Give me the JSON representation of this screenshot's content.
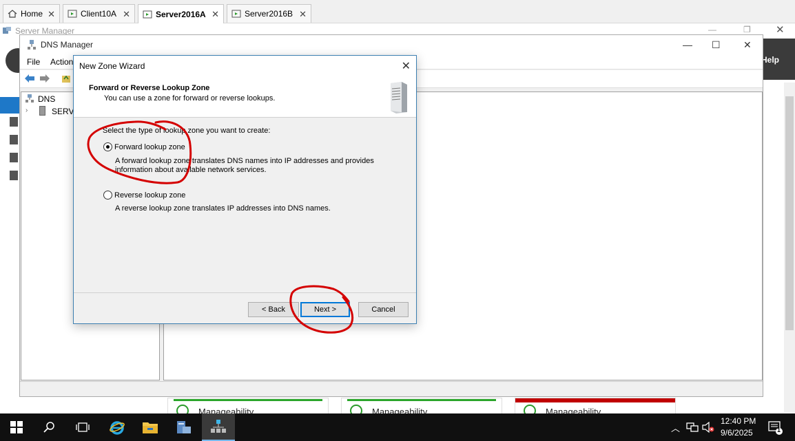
{
  "vm_tabs": [
    {
      "label": "Home",
      "active": false
    },
    {
      "label": "Client10A",
      "active": false
    },
    {
      "label": "Server2016A",
      "active": true
    },
    {
      "label": "Server2016B",
      "active": false
    }
  ],
  "server_manager": {
    "title": "Server Manager",
    "help_label": "Help",
    "tiles": [
      {
        "label": "Manageability",
        "status_color": "#2aa52a"
      },
      {
        "label": "Manageability",
        "status_color": "#2aa52a"
      },
      {
        "label": "Manageability",
        "status_color": "#c00000"
      }
    ]
  },
  "dns_manager": {
    "title": "DNS Manager",
    "menu": [
      "File",
      "Action"
    ],
    "tree": {
      "root": "DNS",
      "child": "SERVE"
    }
  },
  "wizard": {
    "title": "New Zone Wizard",
    "heading": "Forward or Reverse Lookup Zone",
    "subheading": "You can use a zone for forward or reverse lookups.",
    "prompt": "Select the type of lookup zone you want to create:",
    "options": [
      {
        "label": "Forward lookup zone",
        "selected": true,
        "description_line1": "A forward lookup zone translates DNS names into IP addresses and provides",
        "description_line2": "information about available network services."
      },
      {
        "label": "Reverse lookup zone",
        "selected": false,
        "description_line1": "A reverse lookup zone translates IP addresses into DNS names."
      }
    ],
    "buttons": {
      "back": "< Back",
      "next": "Next >",
      "cancel": "Cancel"
    }
  },
  "taskbar": {
    "time": "12:40 PM",
    "date": "9/6/2025",
    "notification_count": "1",
    "icons": [
      "windows-start-icon",
      "search-icon",
      "task-view-icon",
      "internet-explorer-icon",
      "file-explorer-icon",
      "server-manager-icon",
      "dns-manager-icon"
    ]
  },
  "colors": {
    "annotation": "#d40000",
    "accent": "#0078d7"
  }
}
